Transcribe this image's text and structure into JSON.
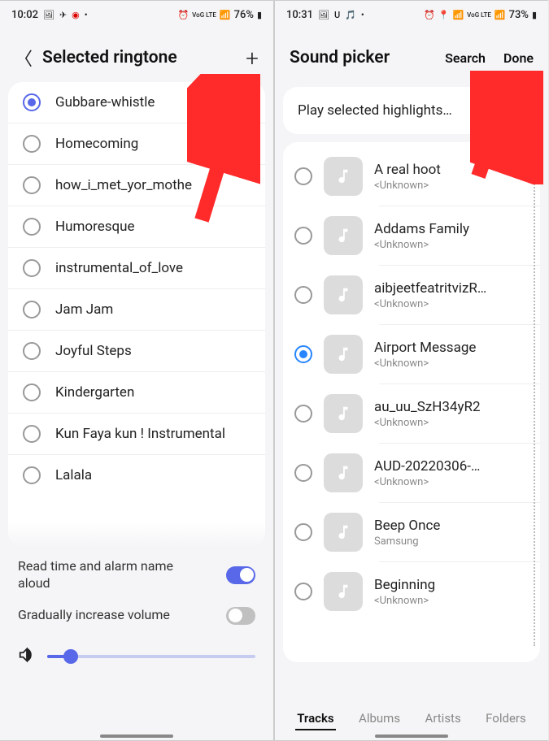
{
  "left": {
    "status": {
      "time": "10:02",
      "battery": "76%"
    },
    "header": {
      "title": "Selected ringtone"
    },
    "ringtones": [
      {
        "label": "Gubbare-whistle",
        "selected": true
      },
      {
        "label": "Homecoming",
        "selected": false
      },
      {
        "label": "how_i_met_yor_mothe",
        "selected": false
      },
      {
        "label": "Humoresque",
        "selected": false
      },
      {
        "label": "instrumental_of_love",
        "selected": false
      },
      {
        "label": "Jam Jam",
        "selected": false
      },
      {
        "label": "Joyful Steps",
        "selected": false
      },
      {
        "label": "Kindergarten",
        "selected": false
      },
      {
        "label": "Kun Faya kun ! Instrumental",
        "selected": false
      },
      {
        "label": "Lalala",
        "selected": false
      }
    ],
    "settings": {
      "read_aloud_label": "Read time and alarm name aloud",
      "read_aloud_on": true,
      "gradual_label": "Gradually increase volume",
      "gradual_on": false
    }
  },
  "right": {
    "status": {
      "time": "10:31",
      "battery": "73%"
    },
    "header": {
      "title": "Sound picker",
      "search": "Search",
      "done": "Done"
    },
    "highlight": "Play selected highlights…",
    "highlight_on": true,
    "sounds": [
      {
        "title": "A real hoot",
        "sub": "<Unknown>",
        "selected": false
      },
      {
        "title": "Addams Family",
        "sub": "<Unknown>",
        "selected": false
      },
      {
        "title": "aibjeetfeatritvizR…",
        "sub": "<Unknown>",
        "selected": false
      },
      {
        "title": "Airport Message",
        "sub": "<Unknown>",
        "selected": true
      },
      {
        "title": "au_uu_SzH34yR2",
        "sub": "<Unknown>",
        "selected": false
      },
      {
        "title": "AUD-20220306-…",
        "sub": "<Unknown>",
        "selected": false
      },
      {
        "title": "Beep Once",
        "sub": "Samsung",
        "selected": false
      },
      {
        "title": "Beginning",
        "sub": "<Unknown>",
        "selected": false
      }
    ],
    "tabs": [
      "Tracks",
      "Albums",
      "Artists",
      "Folders"
    ],
    "active_tab": 0
  }
}
